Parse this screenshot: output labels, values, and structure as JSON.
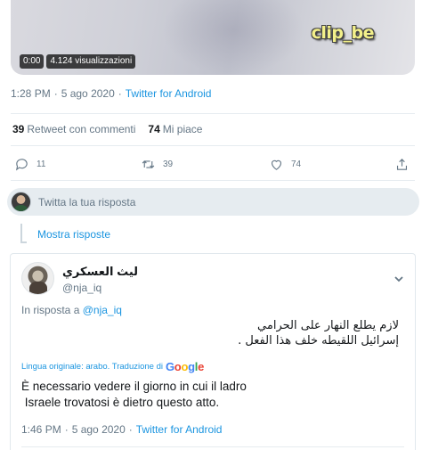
{
  "video": {
    "watermark": "clip_be",
    "time": "0:00",
    "views": "4.124 visualizzazioni"
  },
  "tweet": {
    "time": "1:28 PM",
    "date": "5 ago 2020",
    "source": "Twitter for Android",
    "retweets_count": "39",
    "retweets_label": "Retweet con commenti",
    "likes_count": "74",
    "likes_label": "Mi piace",
    "actions": {
      "reply_count": "11",
      "retweet_count": "39",
      "like_count": "74"
    }
  },
  "reply_box": {
    "placeholder": "Twitta la tua risposta"
  },
  "thread": {
    "show_replies": "Mostra risposte"
  },
  "reply": {
    "name": "ليث العسكري",
    "handle": "@nja_iq",
    "in_reply_prefix": "In risposta a",
    "in_reply_handle": "@nja_iq",
    "text_line1": "لازم يطلع النهار على الحرامي",
    "text_line2": "إسرائيل اللقيطه خلف هذا الفعل .",
    "translation_label": "Lingua originale: arabo. Traduzione di",
    "translation_provider": "Google",
    "translation_line1": "È necessario vedere il giorno in cui il ladro",
    "translation_line2": " Israele trovatosi è dietro questo atto.",
    "time": "1:46 PM",
    "date": "5 ago 2020",
    "source": "Twitter for Android"
  },
  "colors": {
    "link": "#1b95e0",
    "muted": "#657786",
    "text": "#14171a",
    "reply_box_bg": "#e6ecf0"
  }
}
